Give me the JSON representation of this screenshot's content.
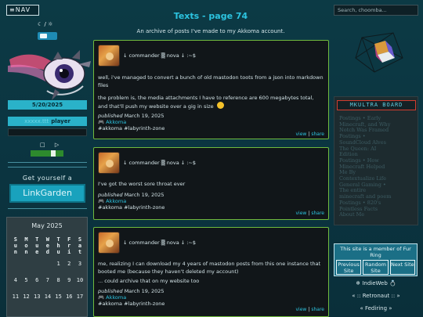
{
  "nav": {
    "label": "≡NAV"
  },
  "mode_icons": "☾ / ☼",
  "left": {
    "date": "5/20/2025",
    "player_tiny": "xxxxx.ttt",
    "player_label": "player",
    "controls": "□ ▷",
    "get_yourself": "Get yourself a",
    "linkgarden": "LinkGarden"
  },
  "calendar": {
    "title": "May 2025",
    "head": [
      "S",
      "M",
      "T",
      "W",
      "T",
      "F",
      "S"
    ],
    "head2": [
      "u",
      "o",
      "u",
      "e",
      "h",
      "r",
      "a"
    ],
    "head3": [
      "n",
      "n",
      "e",
      "d",
      "u",
      "i",
      "t"
    ],
    "rows": [
      [
        "",
        "",
        "",
        "",
        "1",
        "2",
        "3"
      ],
      [
        "4",
        "5",
        "6",
        "7",
        "8",
        "9",
        "10"
      ],
      [
        "11",
        "12",
        "13",
        "14",
        "15",
        "16",
        "17"
      ]
    ]
  },
  "header": {
    "title": "Texts - page 74",
    "subtitle": "An archive of posts I've made to my Akkoma account."
  },
  "posts": [
    {
      "handle": "↓ commander ▒ nova ↓ :~$",
      "text1": "well, i've managed to convert a bunch of old mastodon toots from a json into markdown files",
      "text2": "the problem is, the media attachments I have to reference are 600 megabytes total, and that'll push my website over a gig in size",
      "published": "published",
      "date": "March 19, 2025",
      "category_icon": "🎮",
      "category": "Akkoma",
      "tags": "#akkoma #labyrinth-zone",
      "view": "view",
      "share": "share"
    },
    {
      "handle": "↓ commander ▒ nova ↓ :~$",
      "text1": "I've got the worst sore throat ever",
      "published": "published",
      "date": "March 19, 2025",
      "category_icon": "🎮",
      "category": "Akkoma",
      "tags": "#akkoma #labyrinth-zone",
      "view": "view",
      "share": "share"
    },
    {
      "handle": "↓ commander ▒ nova ↓ :~$",
      "text1": "me, realizing I can download my 4 years of mastodon posts from this one instance that booted me (because they haven't deleted my account)",
      "text2": "... could archive that on my website too",
      "published": "published",
      "date": "March 19, 2025",
      "category_icon": "🎮",
      "category": "Akkoma",
      "tags": "#akkoma #labyrinth-zone",
      "view": "view",
      "share": "share"
    }
  ],
  "search": {
    "placeholder": "Search, choomba..."
  },
  "webring": {
    "title": "MKULTRA BOARD",
    "items": [
      "Postings • Early",
      "Minecraft, and Why",
      "Notch Was Framed",
      "Postings •",
      "SoundCloud Alves",
      "The Queen: AI",
      "Edition",
      "Postings • How",
      "Minecraft Helped",
      "Me By",
      "Contextualize Life",
      "General Gaming •",
      "The entire",
      "minecraft and poem",
      "Postings • 820's",
      "Pointless Facts",
      "About Me"
    ]
  },
  "furring": {
    "title": "This site is a member of Fur Ring",
    "previous": "Previous Site",
    "random": "Random Site",
    "next": "Next Site"
  },
  "rings": {
    "indieweb": "❄ IndieWeb 💍",
    "retronaut": "« :: Retronaut :: »",
    "fediring": "« Fediring »"
  }
}
